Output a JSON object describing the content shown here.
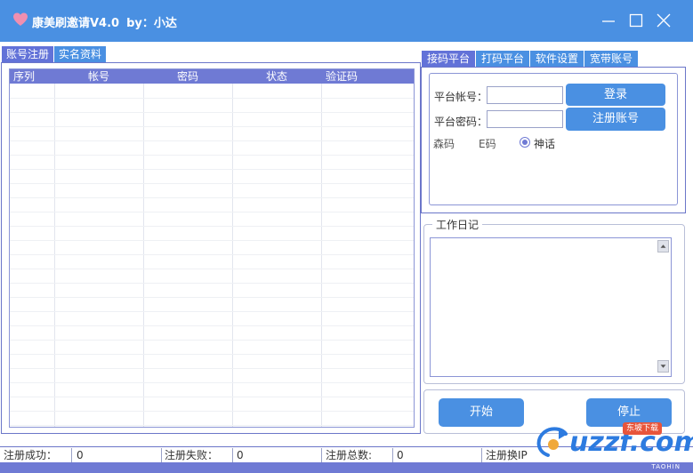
{
  "window": {
    "title": "康美刷邀请V4.0",
    "author": "by：小达"
  },
  "left_tabs": [
    {
      "label": "账号注册",
      "active": true
    },
    {
      "label": "实名资料",
      "active": false
    }
  ],
  "grid": {
    "columns": [
      "序列",
      "帐号",
      "密码",
      "状态",
      "验证码"
    ],
    "rows": []
  },
  "right_tabs": [
    {
      "label": "接码平台",
      "active": true
    },
    {
      "label": "打码平台",
      "active": false
    },
    {
      "label": "软件设置",
      "active": false
    },
    {
      "label": "宽带账号",
      "active": false
    }
  ],
  "platform": {
    "account_label": "平台帐号：",
    "account_value": "",
    "password_label": "平台密码：",
    "password_value": "",
    "login_button": "登录",
    "register_button": "注册账号",
    "options": [
      {
        "label": "森码",
        "selected": false
      },
      {
        "label": "E码",
        "selected": false
      },
      {
        "label": "神话",
        "selected": true
      }
    ]
  },
  "diary": {
    "title": "工作日记",
    "content": ""
  },
  "actions": {
    "start": "开始",
    "stop": "停止"
  },
  "status": {
    "success_label": "注册成功：",
    "success_value": "0",
    "fail_label": "注册失败：",
    "fail_value": "0",
    "total_label": "注册总数:",
    "total_value": "0",
    "ip_label": "注册换IP"
  },
  "brand_mark": "TAOHIN",
  "watermark": {
    "logo": "uzzf.com",
    "badge": "东坡下载"
  },
  "colors": {
    "titlebar": "#4a90e2",
    "accent": "#6f7ad4",
    "button": "#4a90e2"
  }
}
